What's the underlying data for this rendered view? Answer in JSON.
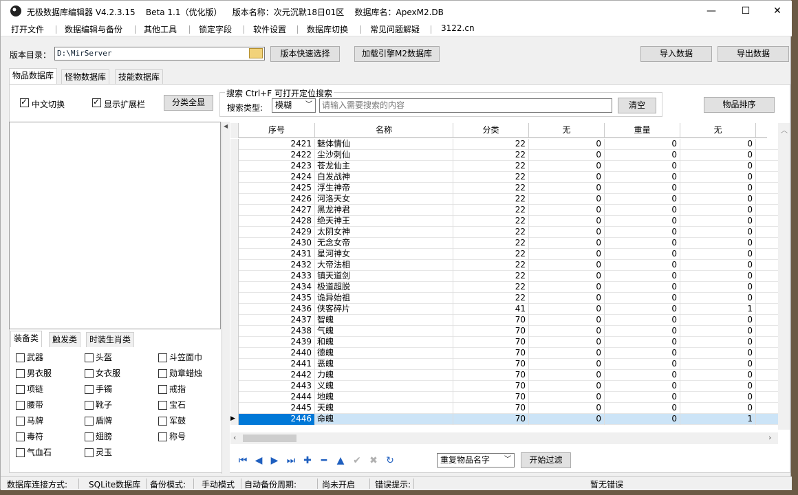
{
  "window": {
    "title": "无极数据库编辑器 V4.2.3.15    Beta 1.1（优化版）    版本名称：次元沉默18日01区    数据库名：ApexM2.DB"
  },
  "menu": [
    "打开文件",
    "数据编辑与备份",
    "其他工具",
    "锁定字段",
    "软件设置",
    "数据库切换",
    "常见问题解疑",
    "3122.cn"
  ],
  "toolbar": {
    "dir_label": "版本目录：",
    "dir_value": "D:\\MirServer",
    "quick_select": "版本快速选择",
    "load_engine": "加载引擎M2数据库",
    "import": "导入数据",
    "export": "导出数据"
  },
  "tabs": [
    "物品数据库",
    "怪物数据库",
    "技能数据库"
  ],
  "options": {
    "chinese_switch": "中文切换",
    "show_ext": "显示扩展栏",
    "show_all_categories": "分类全显"
  },
  "search": {
    "group_title": "搜索   Ctrl+F 可打开定位搜索",
    "type_label": "搜索类型:",
    "type_value": "模糊",
    "placeholder": "请输入需要搜索的内容",
    "clear": "清空",
    "sort": "物品排序"
  },
  "category_tabs": [
    "装备类",
    "触发类",
    "时装生肖类"
  ],
  "categories": [
    "武器",
    "头盔",
    "斗笠面巾",
    "男衣服",
    "女衣服",
    "勋章蜡烛",
    "项链",
    "手镯",
    "戒指",
    "腰带",
    "靴子",
    "宝石",
    "马牌",
    "盾牌",
    "军鼓",
    "毒符",
    "翅膀",
    "称号",
    "气血石",
    "灵玉"
  ],
  "grid": {
    "columns": [
      "序号",
      "名称",
      "分类",
      "无",
      "重量",
      "无"
    ],
    "rows": [
      [
        "2421",
        "魅体情仙",
        "22",
        "0",
        "0",
        "0"
      ],
      [
        "2422",
        "尘沙刺仙",
        "22",
        "0",
        "0",
        "0"
      ],
      [
        "2423",
        "苍龙仙主",
        "22",
        "0",
        "0",
        "0"
      ],
      [
        "2424",
        "白发战神",
        "22",
        "0",
        "0",
        "0"
      ],
      [
        "2425",
        "浮生神帝",
        "22",
        "0",
        "0",
        "0"
      ],
      [
        "2426",
        "河洛天女",
        "22",
        "0",
        "0",
        "0"
      ],
      [
        "2427",
        "黑龙神君",
        "22",
        "0",
        "0",
        "0"
      ],
      [
        "2428",
        "绝天神王",
        "22",
        "0",
        "0",
        "0"
      ],
      [
        "2429",
        "太阴女神",
        "22",
        "0",
        "0",
        "0"
      ],
      [
        "2430",
        "无念女帝",
        "22",
        "0",
        "0",
        "0"
      ],
      [
        "2431",
        "星河神女",
        "22",
        "0",
        "0",
        "0"
      ],
      [
        "2432",
        "大帝法相",
        "22",
        "0",
        "0",
        "0"
      ],
      [
        "2433",
        "镇天道剑",
        "22",
        "0",
        "0",
        "0"
      ],
      [
        "2434",
        "极道超脱",
        "22",
        "0",
        "0",
        "0"
      ],
      [
        "2435",
        "诡异始祖",
        "22",
        "0",
        "0",
        "0"
      ],
      [
        "2436",
        "侠客碎片",
        "41",
        "0",
        "0",
        "1"
      ],
      [
        "2437",
        "智魄",
        "70",
        "0",
        "0",
        "0"
      ],
      [
        "2438",
        "气魄",
        "70",
        "0",
        "0",
        "0"
      ],
      [
        "2439",
        "和魄",
        "70",
        "0",
        "0",
        "0"
      ],
      [
        "2440",
        "德魄",
        "70",
        "0",
        "0",
        "0"
      ],
      [
        "2441",
        "恶魄",
        "70",
        "0",
        "0",
        "0"
      ],
      [
        "2442",
        "力魄",
        "70",
        "0",
        "0",
        "0"
      ],
      [
        "2443",
        "义魄",
        "70",
        "0",
        "0",
        "0"
      ],
      [
        "2444",
        "地魄",
        "70",
        "0",
        "0",
        "0"
      ],
      [
        "2445",
        "天魄",
        "70",
        "0",
        "0",
        "0"
      ],
      [
        "2446",
        "命魄",
        "70",
        "0",
        "0",
        "1"
      ]
    ],
    "selected_row": 25
  },
  "bottom": {
    "filter_select": "重复物品名字",
    "start_filter": "开始过滤"
  },
  "status": {
    "conn_label": "数据库连接方式:",
    "conn_value": "SQLite数据库",
    "backup_label": "备份模式:",
    "backup_value": "手动模式",
    "auto_label": "自动备份周期:",
    "auto_value": "尚未开启",
    "error_label": "错误提示:",
    "error_value": "暂无错误"
  }
}
